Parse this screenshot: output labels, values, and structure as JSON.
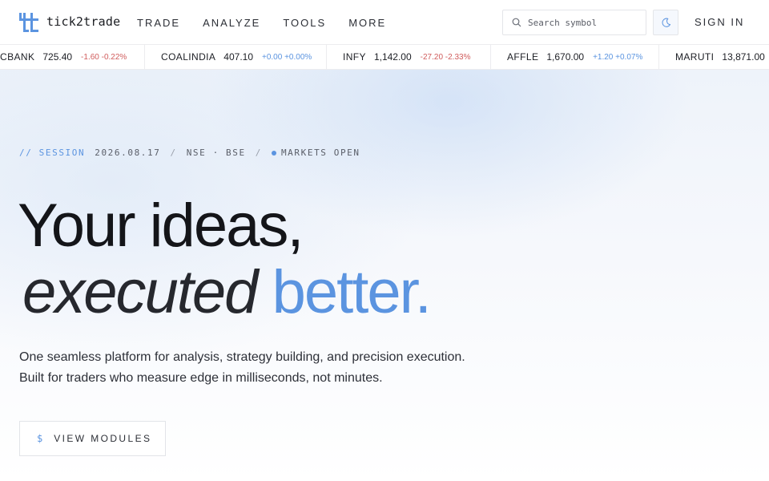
{
  "brand": {
    "name": "tick2trade"
  },
  "nav": {
    "links": [
      "TRADE",
      "ANALYZE",
      "TOOLS",
      "MORE"
    ],
    "sign_in": "SIGN IN"
  },
  "search": {
    "placeholder": "Search symbol",
    "icon": "search-icon"
  },
  "theme_toggle": {
    "icon": "moon-icon"
  },
  "ticker": [
    {
      "symbol": "CBANK",
      "price": "725.40",
      "change": "-1.60 -0.22%",
      "direction": "down"
    },
    {
      "symbol": "COALINDIA",
      "price": "407.10",
      "change": "+0.00 +0.00%",
      "direction": "up"
    },
    {
      "symbol": "INFY",
      "price": "1,142.00",
      "change": "-27.20 -2.33%",
      "direction": "down"
    },
    {
      "symbol": "AFFLE",
      "price": "1,670.00",
      "change": "+1.20 +0.07%",
      "direction": "up"
    },
    {
      "symbol": "MARUTI",
      "price": "13,871.00",
      "change": "",
      "direction": "up"
    }
  ],
  "session": {
    "prefix": "// SESSION",
    "date": "2026.08.17",
    "sep1": "/",
    "exchanges": "NSE · BSE",
    "sep2": "/",
    "status": "MARKETS OPEN"
  },
  "hero": {
    "line1": "Your ideas,",
    "line2_italic": "executed",
    "line2_accent": "better.",
    "subtitle": "One seamless platform for analysis, strategy building, and precision execution. Built for traders who measure edge in milliseconds, not minutes.",
    "cta_symbol": "$",
    "cta_label": "VIEW MODULES"
  },
  "colors": {
    "accent": "#5b94e0",
    "negative": "#d05c5c",
    "text": "#15171c"
  }
}
